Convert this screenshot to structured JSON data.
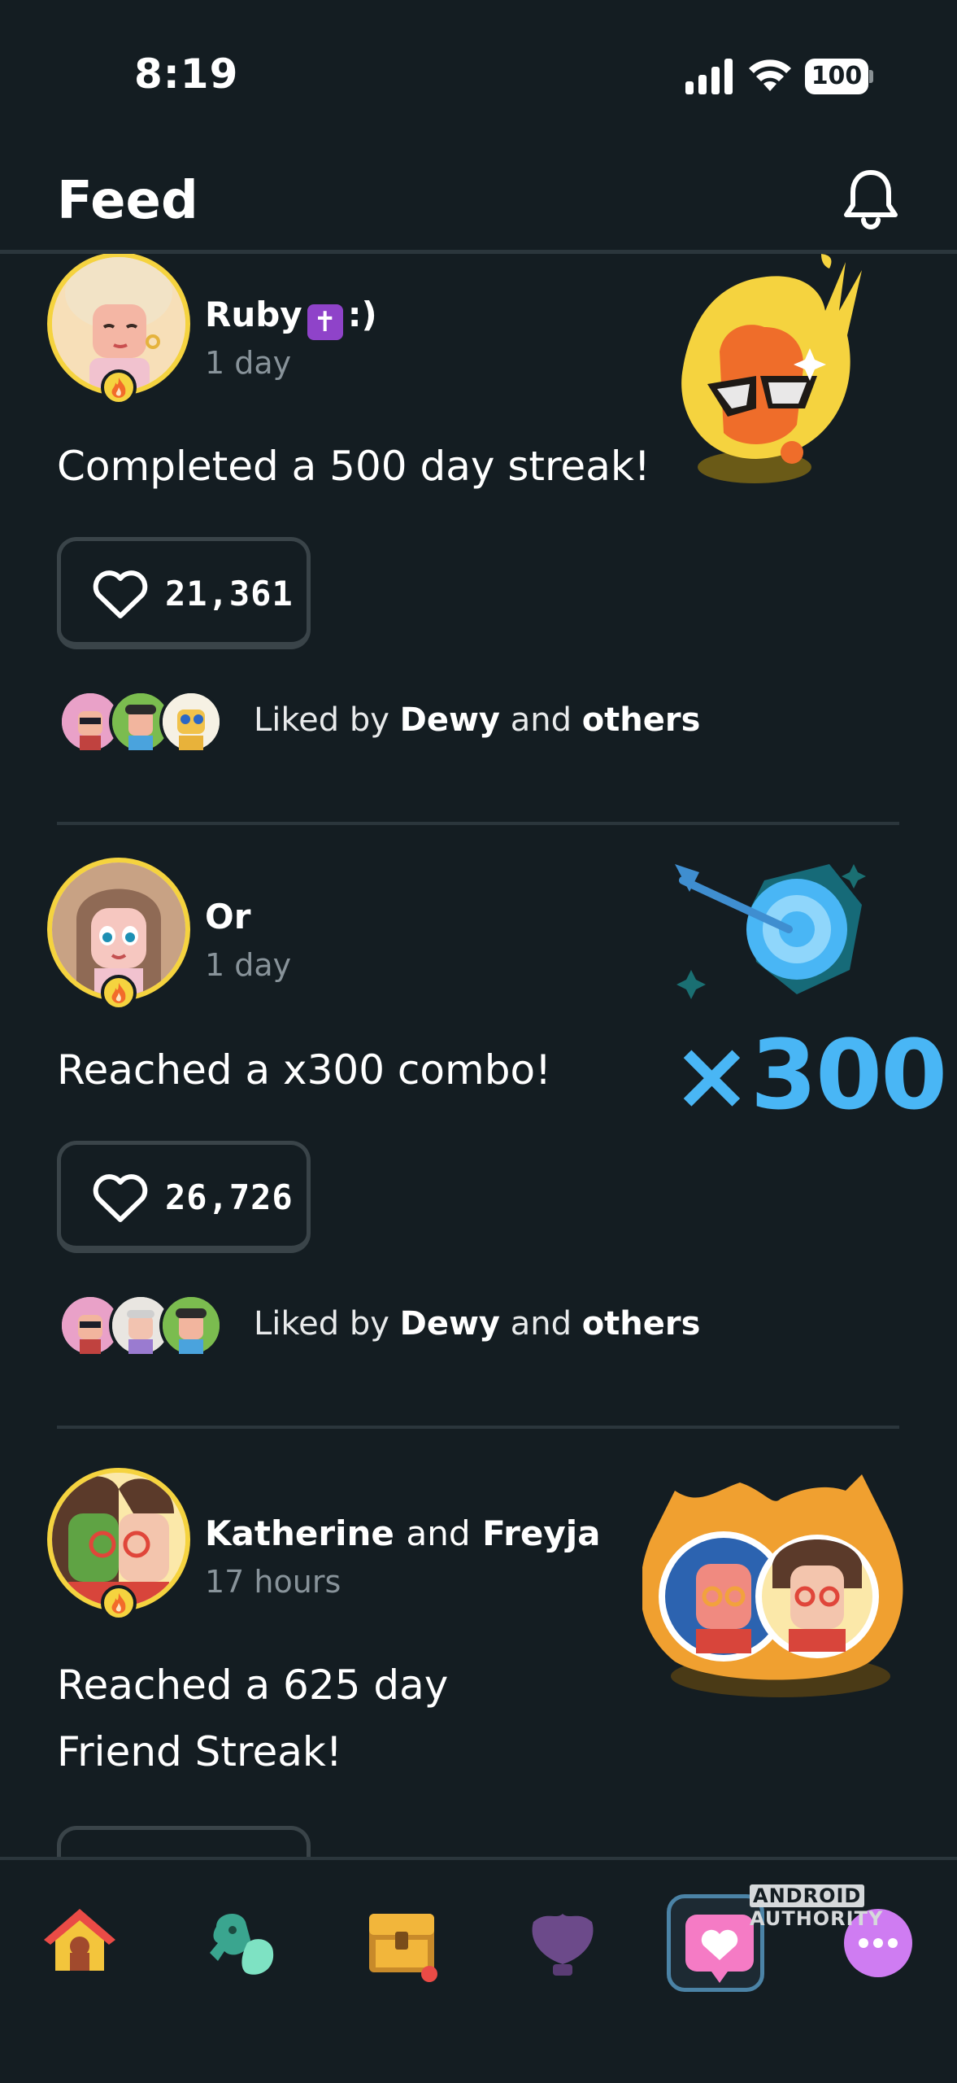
{
  "status_bar": {
    "time": "8:19",
    "battery": "100"
  },
  "header": {
    "title": "Feed",
    "icon": "bell-icon"
  },
  "feed": [
    {
      "user": "Ruby",
      "user_suffix": ":)",
      "user_emoji": "✝",
      "time": "1 day",
      "text": "Completed a 500 day streak!",
      "likes": "21,361",
      "liked_by_prefix": "Liked by",
      "liked_by_name": "Dewy",
      "liked_by_and": "and",
      "liked_by_others": "others",
      "illustration": "flaming-streak-mascot"
    },
    {
      "user": "Or",
      "time": "1 day",
      "text": "Reached a x300 combo!",
      "likes": "26,726",
      "liked_by_prefix": "Liked by",
      "liked_by_name": "Dewy",
      "liked_by_and": "and",
      "liked_by_others": "others",
      "illustration": "target-dart",
      "combo_label": "×300"
    },
    {
      "user": "Katherine",
      "user_and": "and",
      "user2": "Freyja",
      "time": "17 hours",
      "text_line1": "Reached a 625 day",
      "text_line2": "Friend Streak!",
      "illustration": "friend-streak-flames"
    }
  ],
  "bottom_nav": [
    {
      "name": "home",
      "icon": "house-icon"
    },
    {
      "name": "characters",
      "icon": "characters-icon"
    },
    {
      "name": "chest",
      "icon": "treasure-chest-icon"
    },
    {
      "name": "leagues",
      "icon": "shield-icon"
    },
    {
      "name": "feed",
      "icon": "heart-chat-icon",
      "active": true
    },
    {
      "name": "more",
      "icon": "more-icon"
    }
  ],
  "watermark": {
    "brand_box": "ANDROID",
    "brand_text": "AUTHORITY"
  },
  "colors": {
    "background": "#141d22",
    "divider": "#2b363c",
    "streak_gold": "#f5d33f",
    "combo_blue": "#49b6f5",
    "active_nav": "#4b83a6"
  }
}
